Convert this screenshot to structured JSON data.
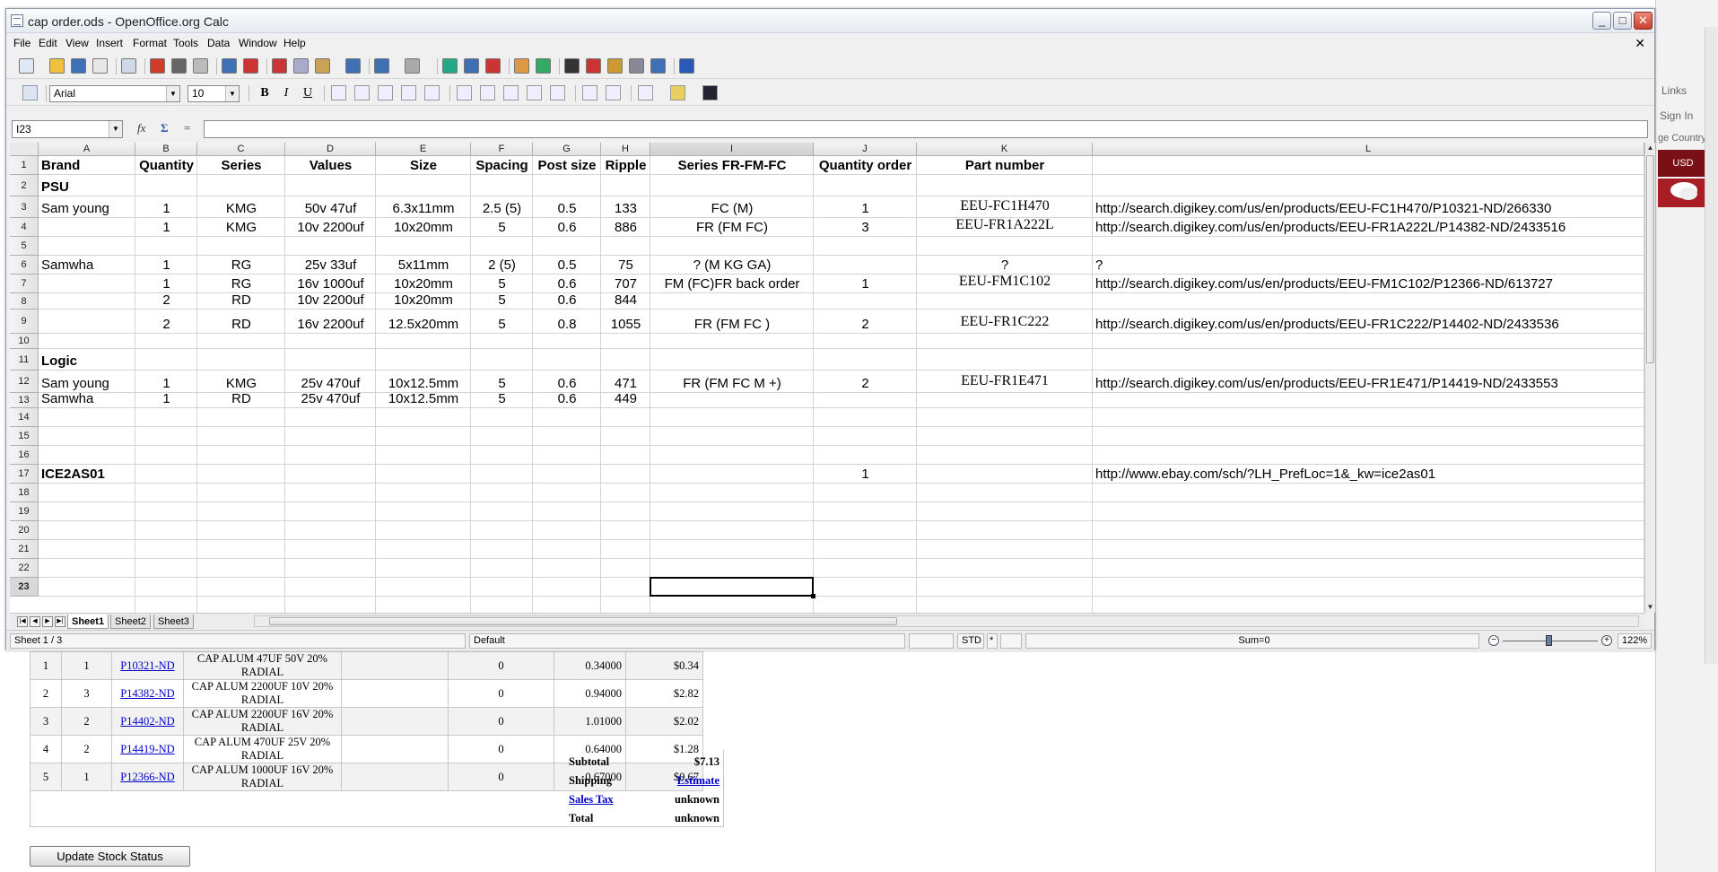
{
  "background": {
    "tabs": [
      "Links",
      "Sign In",
      "ge Country"
    ],
    "currency": "USD"
  },
  "window": {
    "title": "cap order.ods - OpenOffice.org Calc",
    "controls": {
      "minimize": "_",
      "maximize": "□",
      "close": "✕"
    },
    "doc_close": "✕"
  },
  "menu": [
    "File",
    "Edit",
    "View",
    "Insert",
    "Format",
    "Tools",
    "Data",
    "Window",
    "Help"
  ],
  "format_toolbar": {
    "font_name": "Arial",
    "font_size": "10",
    "bold": "B",
    "italic": "I",
    "underline": "U"
  },
  "formula_bar": {
    "cell_ref": "I23",
    "function_wizard": "fx",
    "sum": "Σ",
    "equals": "=",
    "value": ""
  },
  "columns": [
    "A",
    "B",
    "C",
    "D",
    "E",
    "F",
    "G",
    "H",
    "I",
    "J",
    "K",
    "L"
  ],
  "selected_column": "I",
  "rows": [
    "1",
    "2",
    "3",
    "4",
    "5",
    "6",
    "7",
    "8",
    "9",
    "10",
    "11",
    "12",
    "13",
    "14",
    "15",
    "16",
    "17",
    "18",
    "19",
    "20",
    "21",
    "22",
    "23"
  ],
  "selected_row": "23",
  "cells": {
    "r1": {
      "A": "Brand",
      "B": "Quantity",
      "C": "Series",
      "D": "Values",
      "E": "Size",
      "F": "Spacing",
      "G": "Post size",
      "H": "Ripple",
      "I": "Series    FR-FM-FC",
      "J": "Quantity order",
      "K": "Part number"
    },
    "r2": {
      "A": "PSU"
    },
    "r3": {
      "A": "Sam young",
      "B": "1",
      "C": "KMG",
      "D": "50v  47uf",
      "E": "6.3x11mm",
      "F": "2.5 (5)",
      "G": "0.5",
      "H": "133",
      "I": "FC      (M)",
      "J": "1",
      "K": "EEU-FC1H470",
      "L": "http://search.digikey.com/us/en/products/EEU-FC1H470/P10321-ND/266330"
    },
    "r4": {
      "B": "1",
      "C": "KMG",
      "D": "10v  2200uf",
      "E": "10x20mm",
      "F": "5",
      "G": "0.6",
      "H": "886",
      "I": "FR     (FM FC)",
      "J": "3",
      "K": "EEU-FR1A222L",
      "L": "http://search.digikey.com/us/en/products/EEU-FR1A222L/P14382-ND/2433516"
    },
    "r6": {
      "A": "Samwha",
      "B": "1",
      "C": "RG",
      "D": "25v  33uf",
      "E": "5x11mm",
      "F": "2 (5)",
      "G": "0.5",
      "H": "75",
      "I": "?    (M KG GA)",
      "K": "?",
      "L": "?"
    },
    "r7": {
      "B": "1",
      "C": "RG",
      "D": "16v  1000uf",
      "E": "10x20mm",
      "F": "5",
      "G": "0.6",
      "H": "707",
      "I": "FM (FC)FR back order",
      "J": "1",
      "K": "EEU-FM1C102",
      "L": "http://search.digikey.com/us/en/products/EEU-FM1C102/P12366-ND/613727"
    },
    "r8": {
      "B": "2",
      "C": "RD",
      "D": "10v  2200uf",
      "E": "10x20mm",
      "F": "5",
      "G": "0.6",
      "H": "844"
    },
    "r9": {
      "B": "2",
      "C": "RD",
      "D": "16v  2200uf",
      "E": "12.5x20mm",
      "F": "5",
      "G": "0.8",
      "H": "1055",
      "I": "FR     (FM FC )",
      "J": "2",
      "K": "EEU-FR1C222",
      "L": "http://search.digikey.com/us/en/products/EEU-FR1C222/P14402-ND/2433536"
    },
    "r11": {
      "A": "Logic"
    },
    "r12": {
      "A": "Sam young",
      "B": "1",
      "C": "KMG",
      "D": "25v  470uf",
      "E": "10x12.5mm",
      "F": "5",
      "G": "0.6",
      "H": "471",
      "I": "FR     (FM FC M +)",
      "J": "2",
      "K": "EEU-FR1E471",
      "L": "http://search.digikey.com/us/en/products/EEU-FR1E471/P14419-ND/2433553"
    },
    "r13": {
      "A": "Samwha",
      "B": "1",
      "C": "RD",
      "D": "25v  470uf",
      "E": "10x12.5mm",
      "F": "5",
      "G": "0.6",
      "H": "449"
    },
    "r17": {
      "A": "ICE2AS01",
      "J": "1",
      "L": "http://www.ebay.com/sch/?LH_PrefLoc=1&_kw=ice2as01"
    }
  },
  "sheet_tabs": [
    "Sheet1",
    "Sheet2",
    "Sheet3"
  ],
  "active_sheet": "Sheet1",
  "status": {
    "sheet": "Sheet 1 / 3",
    "style": "Default",
    "mode": "STD",
    "modified": "*",
    "sum": "Sum=0",
    "zoom": "122%"
  },
  "order": {
    "rows": [
      {
        "index": "1",
        "qty": "1",
        "part": "P10321-ND",
        "desc": "CAP ALUM 47UF 50V 20% RADIAL",
        "ref": "",
        "backorder": "0",
        "unit": "0.34000",
        "ext": "$0.34"
      },
      {
        "index": "2",
        "qty": "3",
        "part": "P14382-ND",
        "desc": "CAP ALUM 2200UF 10V 20% RADIAL",
        "ref": "",
        "backorder": "0",
        "unit": "0.94000",
        "ext": "$2.82"
      },
      {
        "index": "3",
        "qty": "2",
        "part": "P14402-ND",
        "desc": "CAP ALUM 2200UF 16V 20% RADIAL",
        "ref": "",
        "backorder": "0",
        "unit": "1.01000",
        "ext": "$2.02"
      },
      {
        "index": "4",
        "qty": "2",
        "part": "P14419-ND",
        "desc": "CAP ALUM 470UF 25V 20% RADIAL",
        "ref": "",
        "backorder": "0",
        "unit": "0.64000",
        "ext": "$1.28"
      },
      {
        "index": "5",
        "qty": "1",
        "part": "P12366-ND",
        "desc": "CAP ALUM 1000UF 16V 20% RADIAL",
        "ref": "",
        "backorder": "0",
        "unit": "0.67000",
        "ext": "$0.67"
      }
    ],
    "subtotal_label": "Subtotal",
    "subtotal": "$7.13",
    "shipping_label": "Shipping",
    "shipping": "Estimate",
    "tax_label": "Sales Tax",
    "tax": "unknown",
    "total_label": "Total",
    "total": "unknown",
    "update_button": "Update Stock Status"
  }
}
